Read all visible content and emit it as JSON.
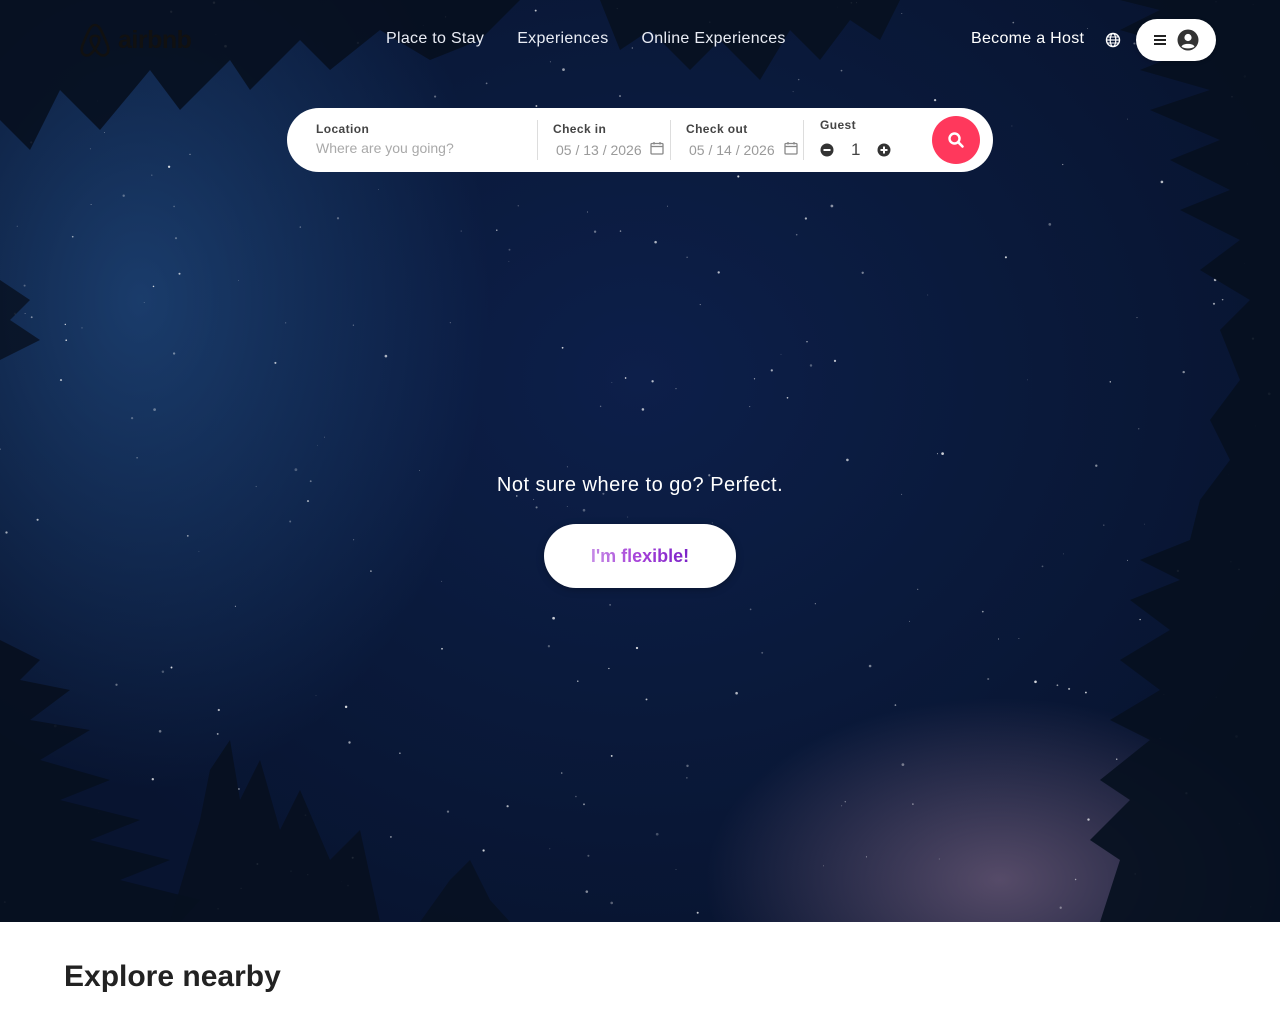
{
  "header": {
    "logo_text": "airbnb",
    "nav": [
      "Place to Stay",
      "Experiences",
      "Online Experiences"
    ],
    "host_label": "Become a Host",
    "icons": {
      "globe": "globe-icon",
      "menu": "hamburger-icon",
      "user": "user-circle-icon"
    }
  },
  "search": {
    "location_label": "Location",
    "location_placeholder": "Where are you going?",
    "checkin_label": "Check in",
    "checkin_value": "05 / 13 / 2026",
    "checkout_label": "Check out",
    "checkout_value": "05 / 14 / 2026",
    "guest_label": "Guest",
    "guest_value": "1"
  },
  "hero": {
    "tagline": "Not sure where to go? Perfect.",
    "flexible_button": "I'm flexible!"
  },
  "sections": {
    "explore_title": "Explore nearby"
  },
  "colors": {
    "brand": "#ff385c",
    "flexible_gradient": [
      "#c58be6",
      "#7a23c7"
    ]
  }
}
